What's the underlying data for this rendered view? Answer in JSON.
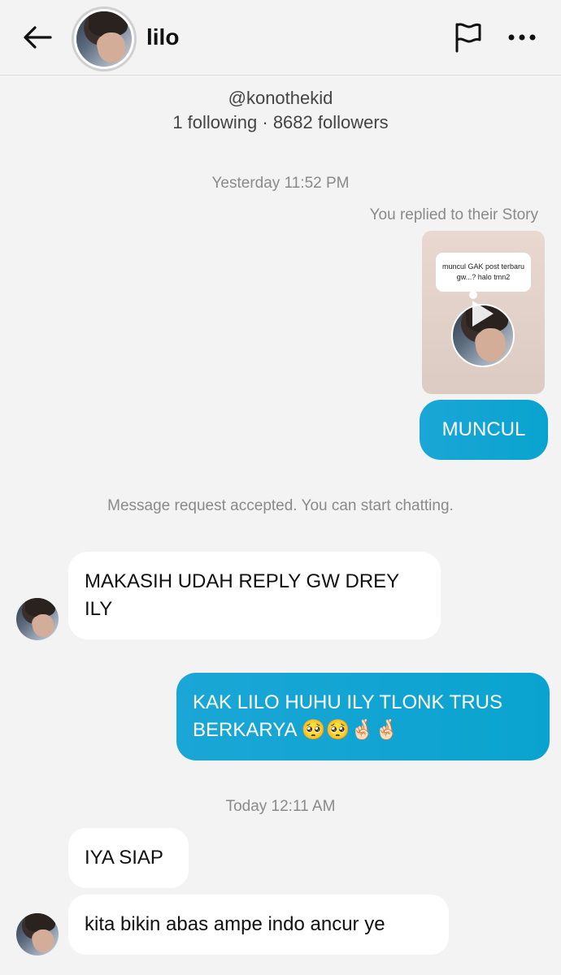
{
  "header": {
    "contact_name": "lilo",
    "back_icon": "arrow-left-icon",
    "flag_icon": "flag-icon",
    "more_icon": "more-horizontal-icon"
  },
  "profile": {
    "handle": "@konothekid",
    "stats": "1 following · 8682 followers"
  },
  "timestamps": {
    "first": "Yesterday 11:52 PM",
    "second": "Today 12:11 AM"
  },
  "story_reply": {
    "note": "You replied to their Story",
    "story_text": "muncul GAK post terbaru gw...? halo tmn2"
  },
  "system_note": "Message request accepted. You can start chatting.",
  "messages": [
    {
      "direction": "outgoing",
      "text": "MUNCUL"
    },
    {
      "direction": "incoming",
      "text": "MAKASIH UDAH REPLY GW DREY ILY"
    },
    {
      "direction": "outgoing",
      "text": "KAK LILO HUHU ILY TLONK TRUS BERKARYA 🥺🥺🤞🏻🤞🏻"
    },
    {
      "direction": "incoming",
      "text": "IYA SIAP"
    },
    {
      "direction": "incoming",
      "text": "kita bikin abas ampe indo ancur ye"
    }
  ],
  "colors": {
    "background": "#f3f3f3",
    "outgoing_bubble": "#0aa3cf",
    "incoming_bubble": "#ffffff",
    "meta_text": "#8a8a8a"
  }
}
